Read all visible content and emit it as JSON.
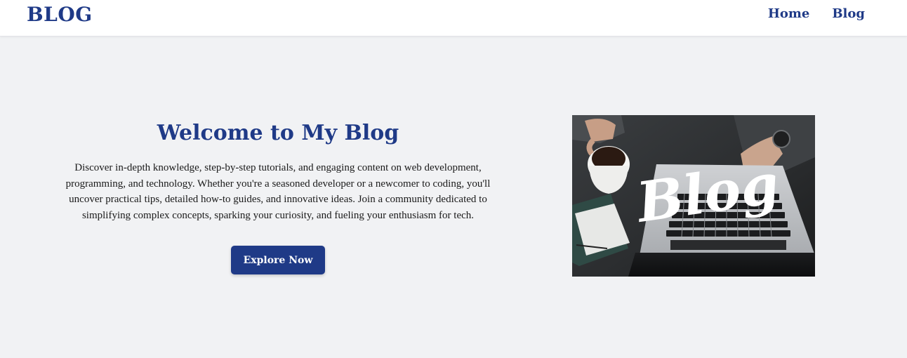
{
  "navbar": {
    "brand": "BLOG",
    "links": [
      "Home",
      "Blog"
    ]
  },
  "hero": {
    "title": "Welcome to My Blog",
    "description": "Discover in-depth knowledge, step-by-step tutorials, and engaging content on web development, programming, and technology. Whether you're a seasoned developer or a newcomer to coding, you'll uncover practical tips, detailed how-to guides, and innovative ideas. Join a community dedicated to simplifying complex concepts, sparking your curiosity, and fueling your enthusiasm for tech.",
    "button_label": "Explore Now",
    "image_text": "Blog"
  },
  "colors": {
    "primary": "#1f3a87",
    "background": "#f1f2f4",
    "navbar_bg": "#ffffff"
  }
}
